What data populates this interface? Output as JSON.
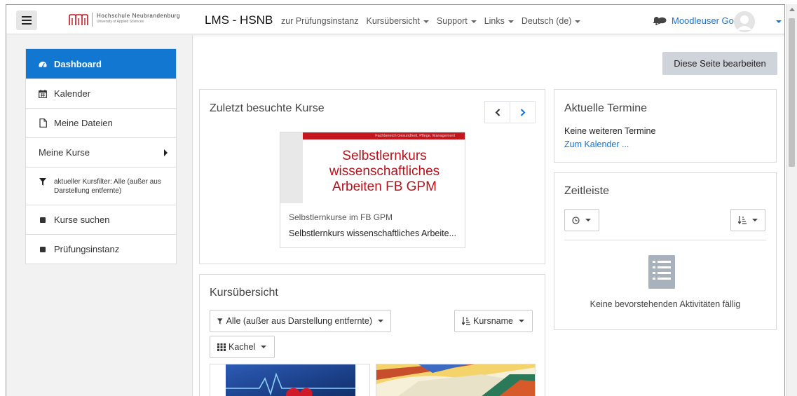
{
  "navbar": {
    "logo_line1": "Hochschule Neubrandenburg",
    "logo_line2": "University of Applied Sciences",
    "site_name": "LMS - HSNB",
    "links": [
      "zur Prüfungsinstanz",
      "Kursübersicht",
      "Support",
      "Links",
      "Deutsch (de)"
    ],
    "user_name": "Moodleuser Go",
    "icons": {
      "menu": "hamburger-icon",
      "notifications": "bell-icon",
      "messages": "chat-bubble-icon",
      "user": "avatar-icon"
    }
  },
  "drawer": {
    "items": [
      {
        "label": "Dashboard",
        "icon": "dashboard-icon",
        "active": true
      },
      {
        "label": "Kalender",
        "icon": "calendar-icon"
      },
      {
        "label": "Meine Dateien",
        "icon": "file-icon"
      },
      {
        "label": "Meine Kurse"
      },
      {
        "label": "aktueller Kursfilter: Alle (außer aus Darstellung entfernte)",
        "icon": "filter-icon"
      },
      {
        "label": "Kurse suchen",
        "icon": "square-bullet-icon"
      },
      {
        "label": "Prüfungsinstanz",
        "icon": "square-bullet-icon"
      }
    ]
  },
  "main": {
    "edit_button": "Diese Seite bearbeiten",
    "recent": {
      "title": "Zuletzt besuchte Kurse",
      "course_header_text": "Fachbereich Gesundheit, Pflege, Management",
      "course_image_title": "Selbstlernkurs wissenschaftliches Arbeiten FB GPM",
      "course_category": "Selbstlernkurse im FB GPM",
      "course_name": "Selbstlernkurs wissenschaftliches Arbeite..."
    },
    "overview": {
      "title": "Kursübersicht",
      "filter_label": "Alle (außer aus Darstellung entfernte)",
      "sort_label": "Kursname",
      "view_label": "Kachel"
    }
  },
  "right": {
    "events": {
      "title": "Aktuelle Termine",
      "empty_text": "Keine weiteren Termine",
      "calendar_link": "Zum Kalender ..."
    },
    "timeline": {
      "title": "Zeitleiste",
      "empty_text": "Keine bevorstehenden Aktivitäten fällig"
    }
  },
  "colors": {
    "accent": "#1177d1",
    "link": "#1174d6",
    "brand_red": "#c3161f"
  }
}
